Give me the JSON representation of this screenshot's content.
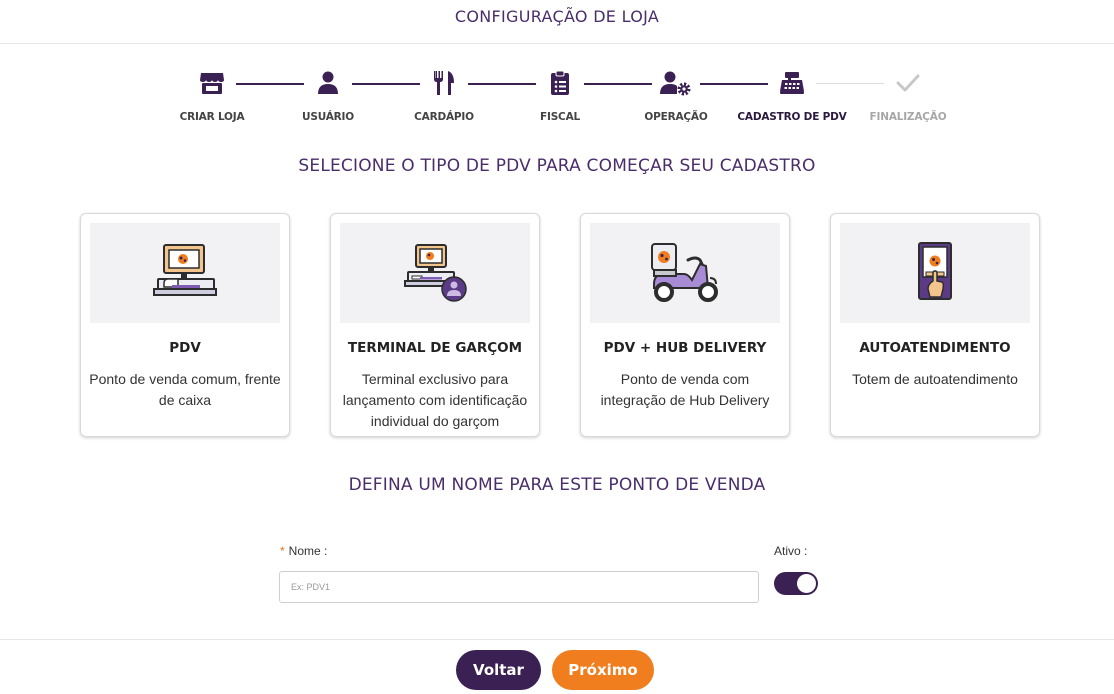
{
  "header": {
    "title": "CONFIGURAÇÃO DE LOJA"
  },
  "stepper": {
    "steps": [
      {
        "label": "CRIAR LOJA",
        "icon": "store-icon",
        "state": "done"
      },
      {
        "label": "USUÁRIO",
        "icon": "user-icon",
        "state": "done"
      },
      {
        "label": "CARDÁPIO",
        "icon": "utensils-icon",
        "state": "done"
      },
      {
        "label": "FISCAL",
        "icon": "clipboard-icon",
        "state": "done"
      },
      {
        "label": "OPERAÇÃO",
        "icon": "user-gear-icon",
        "state": "done"
      },
      {
        "label": "CADASTRO DE PDV",
        "icon": "cash-register-icon",
        "state": "current"
      },
      {
        "label": "FINALIZAÇÃO",
        "icon": "check-icon",
        "state": "future"
      }
    ]
  },
  "pdv_section": {
    "title": "SELECIONE O TIPO DE PDV PARA COMEÇAR SEU CADASTRO",
    "cards": [
      {
        "name": "PDV",
        "desc": "Ponto de venda comum, frente de caixa",
        "illustration": "pos-terminal-illustration"
      },
      {
        "name": "TERMINAL DE GARÇOM",
        "desc": "Terminal exclusivo para lançamento com identificação individual do garçom",
        "illustration": "waiter-terminal-illustration"
      },
      {
        "name": "PDV + HUB DELIVERY",
        "desc": "Ponto de venda com integração de Hub Delivery",
        "illustration": "delivery-scooter-illustration"
      },
      {
        "name": "AUTOATENDIMENTO",
        "desc": "Totem de autoatendimento",
        "illustration": "kiosk-totem-illustration"
      }
    ]
  },
  "name_section": {
    "title": "DEFINA UM NOME PARA ESTE PONTO DE VENDA",
    "nome_label": "Nome :",
    "nome_required_mark": "*",
    "nome_placeholder": "Ex: PDV1",
    "nome_value": "",
    "ativo_label": "Ativo :",
    "ativo_on": true
  },
  "footer": {
    "back_label": "Voltar",
    "next_label": "Próximo"
  },
  "colors": {
    "primary": "#3b2153",
    "accent": "#f07e1e",
    "title": "#4a2d6b"
  }
}
